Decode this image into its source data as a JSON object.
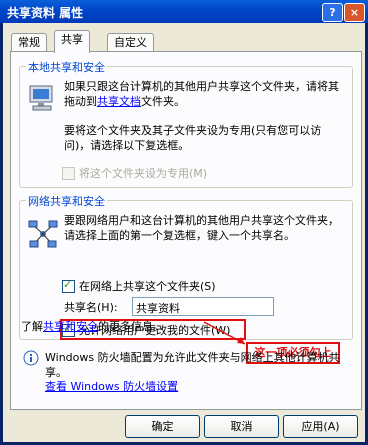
{
  "window": {
    "title": "共享资料 属性",
    "help_button": "?",
    "close_button": "×"
  },
  "tabs": [
    {
      "label": "常规"
    },
    {
      "label": "共享"
    },
    {
      "label": "自定义"
    }
  ],
  "local_group": {
    "title": "本地共享和安全",
    "para1_start": "如果只跟这台计算机的其他用户共享这个文件夹，请将其拖动到",
    "para1_link": "共享文档",
    "para1_end": "文件夹。",
    "para2": "要将这个文件夹及其子文件夹设为专用(只有您可以访问)，请选择以下复选框。",
    "checkbox_private": "将这个文件夹设为专用(M)"
  },
  "network_group": {
    "title": "网络共享和安全",
    "para": "要跟网络用户和这台计算机的其他用户共享这个文件夹，请选择上面的第一个复选框，键入一个共享名。",
    "checkbox_share": "在网络上共享这个文件夹(S)",
    "share_name_label": "共享名(H):",
    "share_name_value": "共享资料",
    "checkbox_allow_change": "允许网络用户更改我的文件(W)"
  },
  "learn_more": {
    "prefix": "了解",
    "link": "共享和安全",
    "suffix": "的更多信息。"
  },
  "annotation": "这一项必须勾上",
  "firewall": {
    "text": "Windows 防火墙配置为允许此文件夹与网络上其他计算机共享。",
    "link": "查看 Windows 防火墙设置"
  },
  "buttons": {
    "ok": "确定",
    "cancel": "取消",
    "apply": "应用(A)"
  }
}
